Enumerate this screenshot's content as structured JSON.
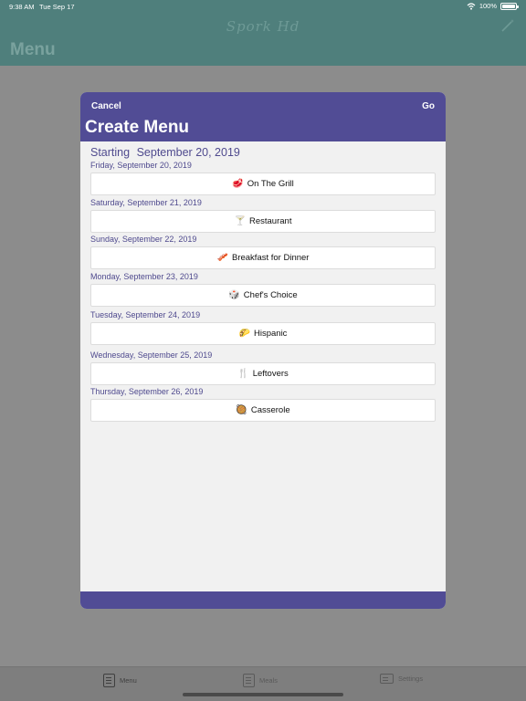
{
  "status_bar": {
    "time": "9:38 AM",
    "date": "Tue Sep 17",
    "battery": "100%"
  },
  "app": {
    "brand": "Spork Hd",
    "title": "Menu"
  },
  "tabs": [
    {
      "label": "Menu"
    },
    {
      "label": "Meals"
    },
    {
      "label": "Settings"
    }
  ],
  "modal": {
    "cancel_label": "Cancel",
    "go_label": "Go",
    "title": "Create Menu",
    "starting_label": "Starting",
    "starting_date": "September 20, 2019",
    "days": [
      {
        "date": "Friday, September 20, 2019",
        "emoji": "🥩",
        "meal": "On The Grill"
      },
      {
        "date": "Saturday, September 21, 2019",
        "emoji": "🍸",
        "meal": "Restaurant"
      },
      {
        "date": "Sunday, September 22, 2019",
        "emoji": "🥓",
        "meal": "Breakfast for Dinner"
      },
      {
        "date": "Monday, September 23, 2019",
        "emoji": "🎲",
        "meal": "Chef's Choice"
      },
      {
        "date": "Tuesday, September 24, 2019",
        "emoji": "🌮",
        "meal": "Hispanic"
      },
      {
        "date": "Wednesday, September 25, 2019",
        "emoji": "🍴",
        "meal": "Leftovers"
      },
      {
        "date": "Thursday, September 26, 2019",
        "emoji": "🥘",
        "meal": "Casserole"
      }
    ]
  }
}
